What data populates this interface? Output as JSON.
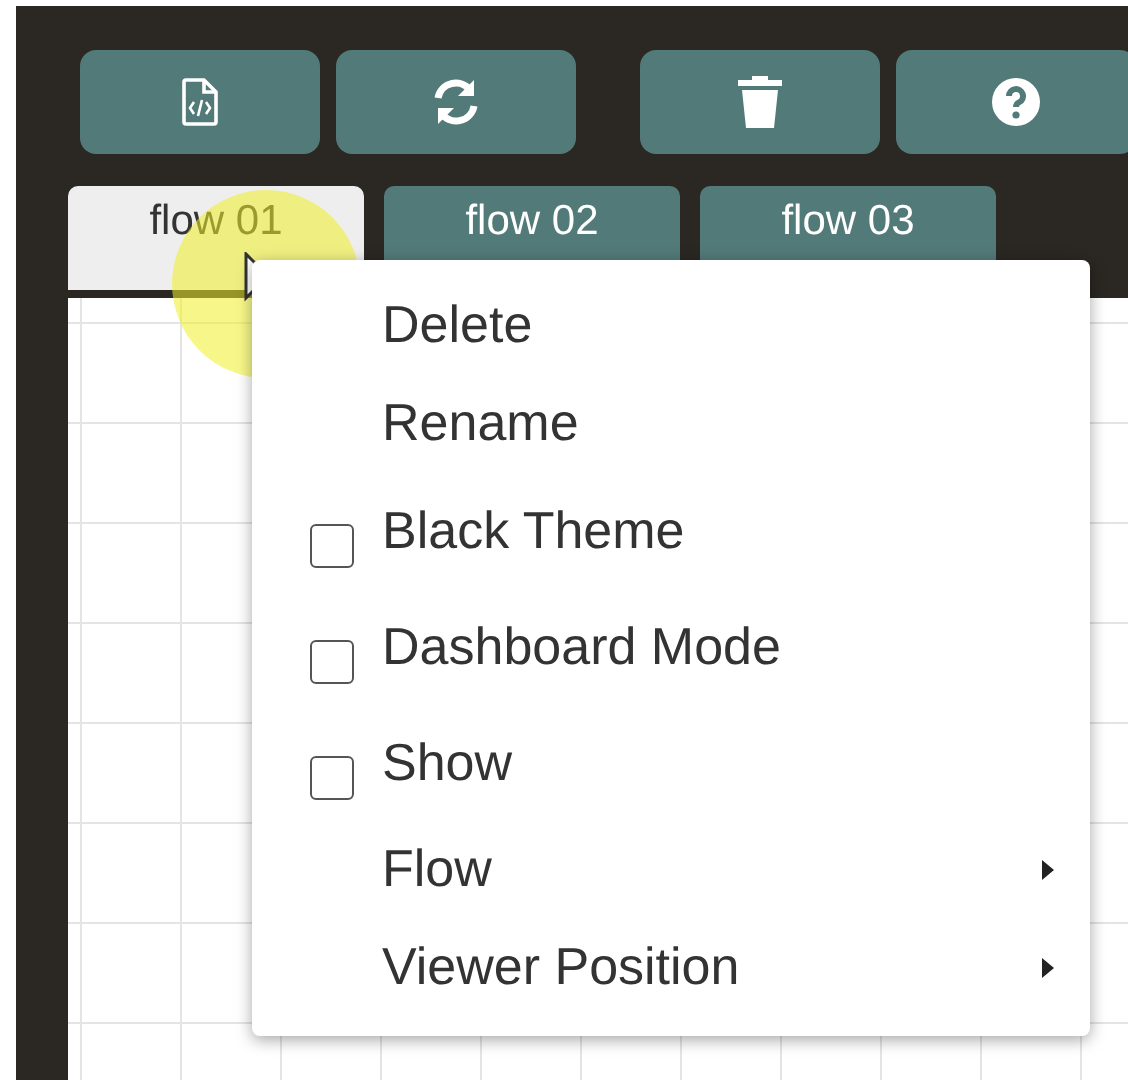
{
  "tabs": [
    {
      "label": "flow 01",
      "selected": true
    },
    {
      "label": "flow 02",
      "selected": false
    },
    {
      "label": "flow 03",
      "selected": false
    }
  ],
  "context_menu": {
    "items": [
      {
        "kind": "plain",
        "label": "Delete"
      },
      {
        "kind": "plain",
        "label": "Rename"
      },
      {
        "kind": "checkbox",
        "label": "Black Theme",
        "checked": false
      },
      {
        "kind": "checkbox",
        "label": "Dashboard Mode",
        "checked": false
      },
      {
        "kind": "checkbox",
        "label": "Show",
        "checked": false
      },
      {
        "kind": "submenu",
        "label": "Flow"
      },
      {
        "kind": "submenu",
        "label": "Viewer Position"
      }
    ]
  }
}
